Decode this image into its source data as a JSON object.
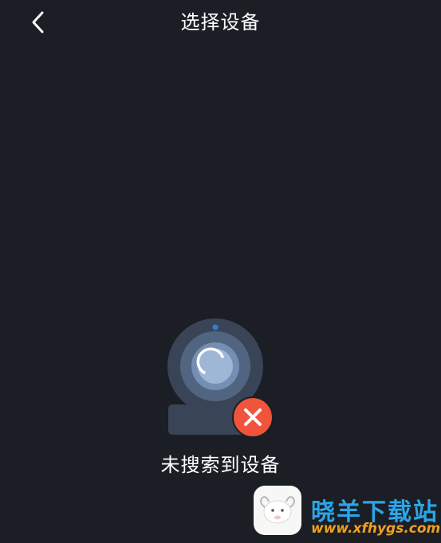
{
  "header": {
    "title": "选择设备",
    "back_icon": "chevron-left-icon"
  },
  "empty_state": {
    "message": "未搜索到设备",
    "illustration_icon": "webcam-icon",
    "error_icon": "close-icon",
    "error_color": "#f0543c"
  },
  "watermark": {
    "title": "晓羊下载站",
    "url": "www.xfhygs.com",
    "logo_icon": "sheep-logo-icon"
  },
  "colors": {
    "background": "#1b1e25",
    "camera_body": "#3a4457",
    "camera_lens": "#9fb7d6",
    "indicator": "#2f7fd8"
  }
}
